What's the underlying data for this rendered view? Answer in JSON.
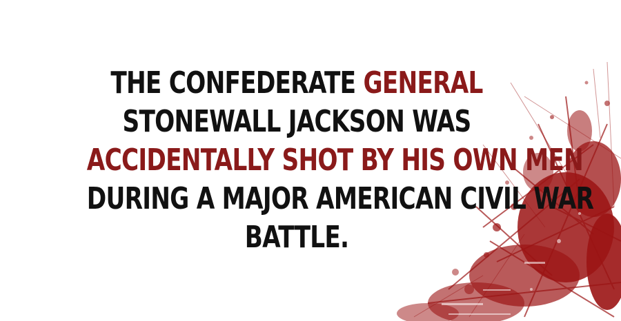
{
  "colors": {
    "text": "#111111",
    "highlight": "#8a1a1a",
    "splatter": "#9b1414",
    "background": "#ffffff"
  },
  "fact": {
    "line1_plain": "THE CONFEDERATE ",
    "line1_highlight": "GENERAL",
    "line2": "STONEWALL JACKSON WAS",
    "line3_highlight": "ACCIDENTALLY SHOT BY HIS OWN MEN",
    "line4": "DURING A MAJOR AMERICAN CIVIL WAR",
    "line5": "BATTLE."
  },
  "decoration": {
    "icon": "blood-splatter-icon"
  }
}
